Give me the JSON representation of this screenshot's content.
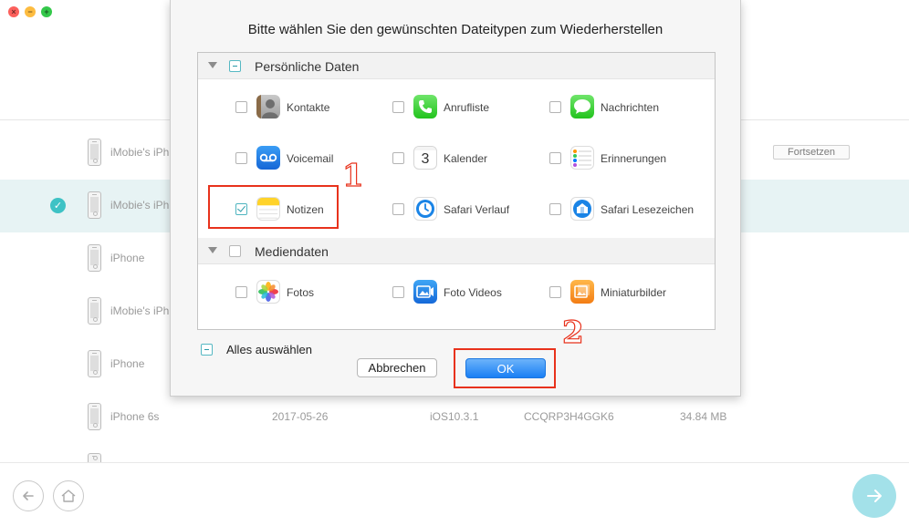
{
  "window": {
    "controls": [
      "close",
      "minimize",
      "zoom"
    ]
  },
  "background_list": {
    "resume_label": "Fortsetzen",
    "rows": [
      {
        "name": "iMobie's iPh",
        "selected": false,
        "date": "",
        "ios": "",
        "id": "",
        "size": ""
      },
      {
        "name": "iMobie's iPh",
        "selected": true,
        "date": "",
        "ios": "",
        "id": "",
        "size": ""
      },
      {
        "name": "iPhone",
        "selected": false,
        "date": "",
        "ios": "",
        "id": "",
        "size": ""
      },
      {
        "name": "iMobie's iPh",
        "selected": false,
        "date": "",
        "ios": "",
        "id": "",
        "size": ""
      },
      {
        "name": "iPhone",
        "selected": false,
        "date": "",
        "ios": "",
        "id": "",
        "size": ""
      },
      {
        "name": "iPhone 6s",
        "selected": false,
        "date": "2017-05-26",
        "ios": "iOS10.3.1",
        "id": "CCQRP3H4GGK6",
        "size": "34.84 MB"
      }
    ]
  },
  "dialog": {
    "title": "Bitte wählen Sie den gewünschten Dateitypen zum Wiederherstellen",
    "sections": [
      {
        "label": "Persönliche Daten",
        "state": "mixed",
        "items": [
          {
            "name": "Kontakte",
            "icon": "contacts-icon",
            "checked": false
          },
          {
            "name": "Anrufliste",
            "icon": "phone-icon",
            "checked": false
          },
          {
            "name": "Nachrichten",
            "icon": "messages-icon",
            "checked": false
          },
          {
            "name": "Voicemail",
            "icon": "voicemail-icon",
            "checked": false
          },
          {
            "name": "Kalender",
            "icon": "calendar-icon",
            "checked": false,
            "calendar_day": "3"
          },
          {
            "name": "Erinnerungen",
            "icon": "reminders-icon",
            "checked": false
          },
          {
            "name": "Notizen",
            "icon": "notes-icon",
            "checked": true
          },
          {
            "name": "Safari Verlauf",
            "icon": "safari-history-icon",
            "checked": false
          },
          {
            "name": "Safari Lesezeichen",
            "icon": "safari-bookmarks-icon",
            "checked": false
          }
        ]
      },
      {
        "label": "Mediendaten",
        "state": "unchecked",
        "items": [
          {
            "name": "Fotos",
            "icon": "photos-icon",
            "checked": false
          },
          {
            "name": "Foto Videos",
            "icon": "photo-videos-icon",
            "checked": false
          },
          {
            "name": "Miniaturbilder",
            "icon": "thumbnails-icon",
            "checked": false
          }
        ]
      }
    ],
    "select_all_label": "Alles auswählen",
    "cancel_label": "Abbrechen",
    "ok_label": "OK"
  },
  "annotations": {
    "step1": "1",
    "step2": "2",
    "color": "#e8321c"
  },
  "colors": {
    "accent": "#3ec2c5",
    "ok_button": "#1a7ff4",
    "selected_row": "#e7f3f4"
  }
}
